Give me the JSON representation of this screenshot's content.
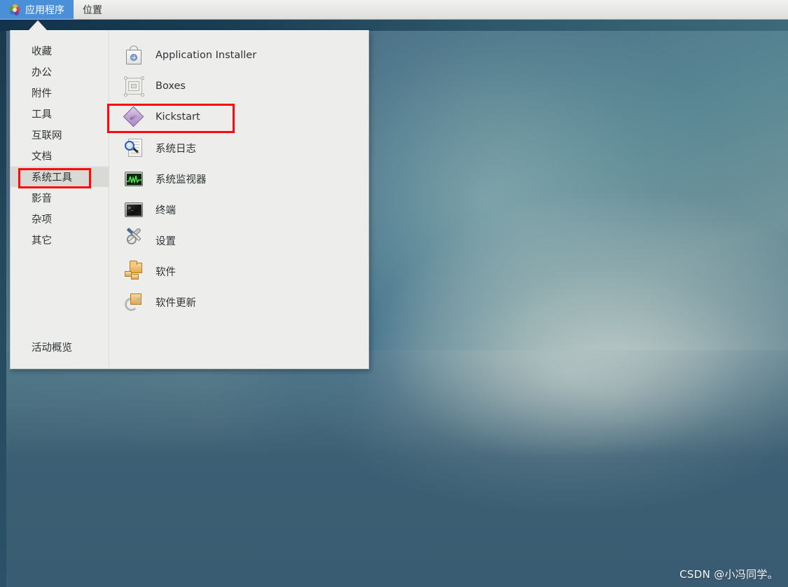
{
  "menubar": {
    "tabs": [
      {
        "label": "应用程序",
        "icon": "gnome-foot-icon",
        "active": true
      },
      {
        "label": "位置",
        "icon": "",
        "active": false
      }
    ],
    "active_color": "#4a90d9"
  },
  "app_menu": {
    "categories": [
      {
        "label": "收藏",
        "selected": false
      },
      {
        "label": "办公",
        "selected": false
      },
      {
        "label": "附件",
        "selected": false
      },
      {
        "label": "工具",
        "selected": false
      },
      {
        "label": "互联网",
        "selected": false
      },
      {
        "label": "文档",
        "selected": false
      },
      {
        "label": "系统工具",
        "selected": true
      },
      {
        "label": "影音",
        "selected": false
      },
      {
        "label": "杂项",
        "selected": false
      },
      {
        "label": "其它",
        "selected": false
      }
    ],
    "activities_label": "活动概览",
    "applications": [
      {
        "label": "Application Installer",
        "icon": "shopping-bag-icon",
        "highlighted": false
      },
      {
        "label": "Boxes",
        "icon": "wireframe-box-icon",
        "highlighted": false
      },
      {
        "label": "Kickstart",
        "icon": "purple-diamond-icon",
        "highlighted": true
      },
      {
        "label": "系统日志",
        "icon": "magnifier-document-icon",
        "highlighted": false
      },
      {
        "label": "系统监视器",
        "icon": "monitor-graph-icon",
        "highlighted": false
      },
      {
        "label": "终端",
        "icon": "terminal-icon",
        "highlighted": false
      },
      {
        "label": "设置",
        "icon": "wrench-screwdriver-icon",
        "highlighted": false
      },
      {
        "label": "软件",
        "icon": "package-folder-icon",
        "highlighted": false
      },
      {
        "label": "软件更新",
        "icon": "package-refresh-icon",
        "highlighted": false
      }
    ]
  },
  "annotations": {
    "color": "#fa0a0a",
    "boxes": [
      {
        "target": "Kickstart"
      },
      {
        "target": "系统工具"
      }
    ]
  },
  "watermark": {
    "text": "CSDN @小冯同学。"
  }
}
